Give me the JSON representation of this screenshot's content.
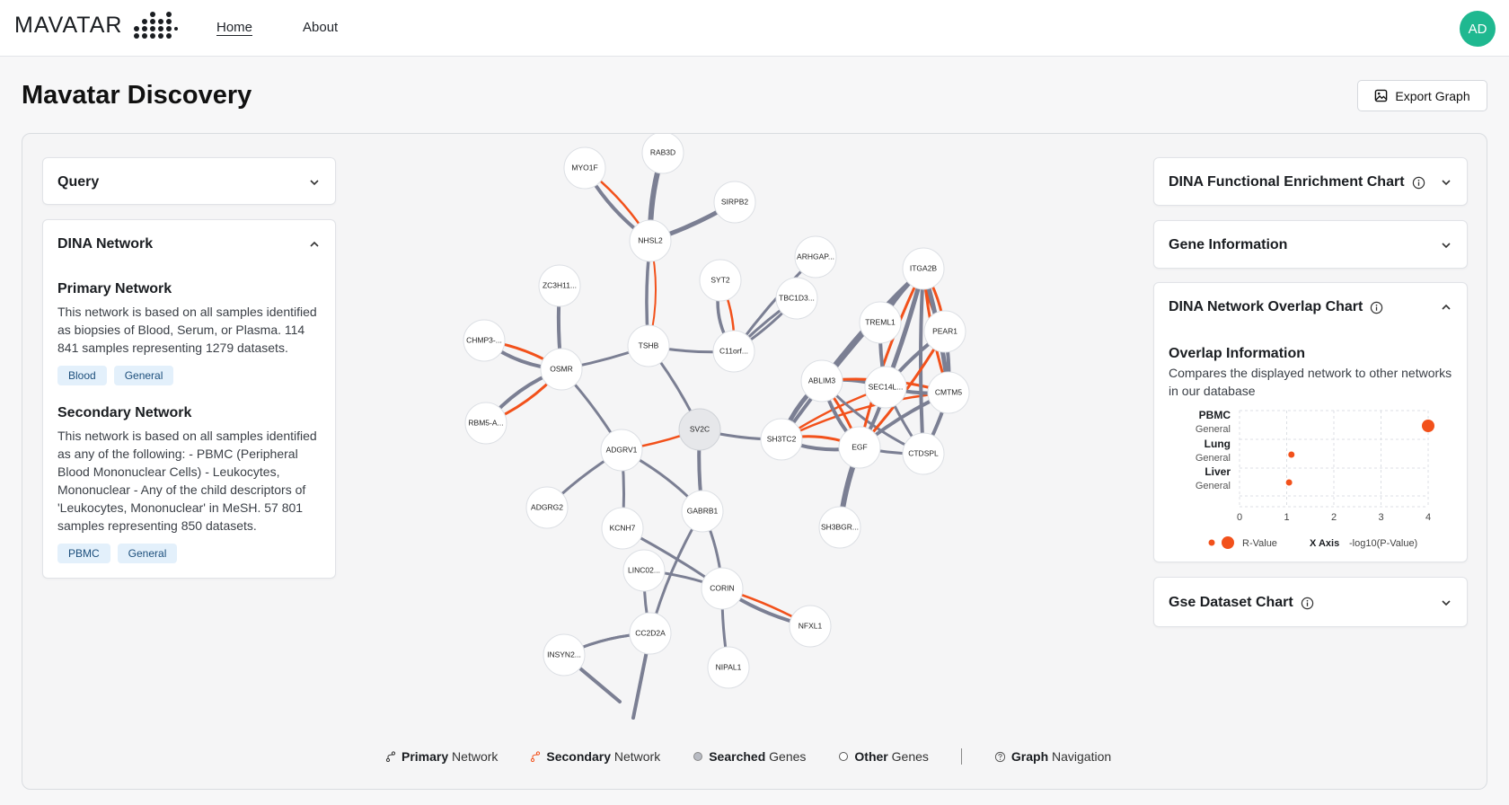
{
  "brand": {
    "name": "MAVATAR"
  },
  "nav": {
    "home": "Home",
    "about": "About"
  },
  "user": {
    "initials": "AD"
  },
  "page": {
    "title": "Mavatar Discovery",
    "export_label": "Export Graph"
  },
  "left": {
    "query_title": "Query",
    "dina_title": "DINA Network",
    "primary": {
      "title": "Primary Network",
      "text": "This network is based on all samples identified as biopsies of Blood, Serum, or Plasma. 114 841 samples representing 1279 datasets.",
      "tags": [
        "Blood",
        "General"
      ]
    },
    "secondary": {
      "title": "Secondary Network",
      "text": "This network is based on all samples identified as any of the following: - PBMC (Peripheral Blood Mononuclear Cells) - Leukocytes, Mononuclear - Any of the child descriptors of 'Leukocytes, Mononuclear' in MeSH. 57 801 samples representing 850 datasets.",
      "tags": [
        "PBMC",
        "General"
      ]
    }
  },
  "right": {
    "enrichment_title": "DINA Functional Enrichment Chart",
    "gene_info_title": "Gene Information",
    "overlap_title": "DINA Network Overlap Chart",
    "overlap_info_title": "Overlap Information",
    "overlap_info_text": "Compares the displayed network to other networks in our database",
    "gse_title": "Gse Dataset Chart"
  },
  "chart_data": {
    "type": "scatter",
    "categories": [
      {
        "name": "PBMC",
        "sub": "General"
      },
      {
        "name": "Lung",
        "sub": "General"
      },
      {
        "name": "Liver",
        "sub": "General"
      }
    ],
    "x": [
      4.0,
      1.1,
      1.05
    ],
    "r_value": [
      "large",
      "small",
      "small"
    ],
    "xlim": [
      0,
      4
    ],
    "xticks": [
      "0",
      "1",
      "2",
      "3",
      "4"
    ],
    "legend": {
      "size_label": "R-Value",
      "axis_label": "X Axis",
      "axis_value": "-log10(P-Value)"
    },
    "colors": {
      "point": "#f2511b"
    }
  },
  "graph": {
    "colors": {
      "primary": "#7b7f93",
      "secondary": "#f2511b"
    },
    "nodes": [
      "MYO1F",
      "RAB3D",
      "SIRPB2",
      "NHSL2",
      "ZC3H11...",
      "SYT2",
      "ARHGAP...",
      "TBC1D3...",
      "ITGA2B",
      "TREML1",
      "PEAR1",
      "CHMP3-...",
      "OSMR",
      "TSHB",
      "C11orf...",
      "ABLIM3",
      "SEC14L...",
      "CMTM5",
      "RBM5-A...",
      "SV2C",
      "SH3TC2",
      "EGF",
      "CTDSPL",
      "ADGRV1",
      "ADGRG2",
      "GABRB1",
      "KCNH7",
      "SH3BGR...",
      "LINC02...",
      "CORIN",
      "NFXL1",
      "CC2D2A",
      "INSYN2...",
      "NIPAL1"
    ],
    "searched": [
      "SV2C"
    ]
  },
  "legend": {
    "primary_bold": "Primary",
    "primary_rest": " Network",
    "secondary_bold": "Secondary",
    "secondary_rest": " Network",
    "searched_bold": "Searched",
    "searched_rest": " Genes",
    "other_bold": "Other",
    "other_rest": " Genes",
    "nav_bold": "Graph",
    "nav_rest": " Navigation"
  }
}
